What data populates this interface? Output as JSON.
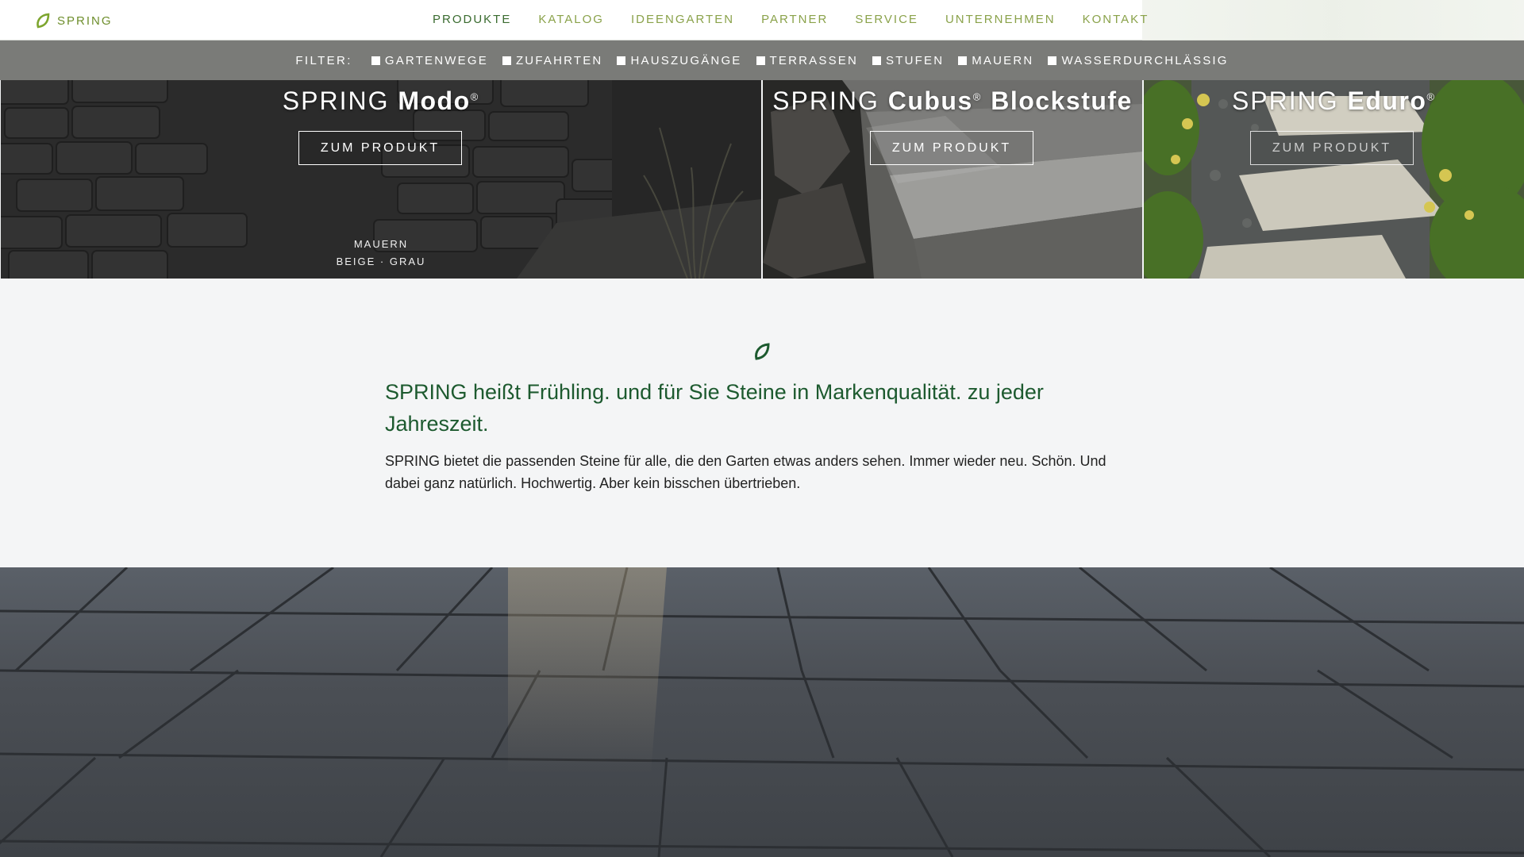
{
  "header": {
    "logo_text": "SPRING",
    "nav": [
      {
        "label": "PRODUKTE",
        "active": true
      },
      {
        "label": "KATALOG"
      },
      {
        "label": "IDEENGARTEN"
      },
      {
        "label": "PARTNER"
      },
      {
        "label": "SERVICE"
      },
      {
        "label": "UNTERNEHMEN"
      },
      {
        "label": "KONTAKT"
      }
    ]
  },
  "filter": {
    "label": "FILTER:",
    "options": [
      "GARTENWEGE",
      "ZUFAHRTEN",
      "HAUSZUGÄNGE",
      "TERRASSEN",
      "STUFEN",
      "MAUERN",
      "WASSERDURCHLÄSSIG"
    ]
  },
  "tiles": [
    {
      "brand": "SPRING",
      "name": "Modo",
      "mark": "®",
      "button": "ZUM PRODUKT",
      "category": "MAUERN",
      "colors": "BEIGE · GRAU"
    },
    {
      "brand": "SPRING",
      "name": "Cubus",
      "mark": "®",
      "name2": "Blockstufe",
      "button": "ZUM PRODUKT"
    },
    {
      "brand": "SPRING",
      "name": "Eduro",
      "mark": "®",
      "button": "ZUM PRODUKT"
    }
  ],
  "intro": {
    "heading": "SPRING heißt Frühling. und für Sie Steine in Markenqualität. zu jeder Jahreszeit.",
    "text": "SPRING bietet die passenden Steine für alle, die den Garten etwas anders sehen. Immer wieder neu. Schön. Und dabei ganz natürlich. Hochwertig. Aber kein bisschen übertrieben."
  },
  "colors": {
    "brand_green": "#1d5a2f",
    "nav_green": "#8aa24a",
    "filter_bg": "#7a7b78"
  }
}
